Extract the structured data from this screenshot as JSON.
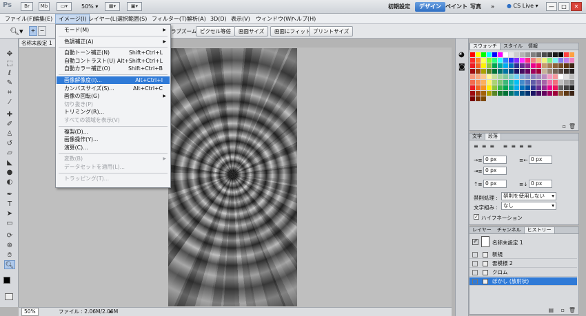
{
  "app": {
    "logo": "Ps",
    "zoom": "50%"
  },
  "workspace": {
    "buttons": [
      "初期設定",
      "デザイン",
      "ペイント",
      "写真"
    ],
    "active": 1,
    "more": "»",
    "cslive": "CS Live"
  },
  "window_controls": {
    "minimize": "—",
    "maximize": "□",
    "close": "✕"
  },
  "menubar": [
    "ファイル(F)",
    "編集(E)",
    "イメージ(I)",
    "レイヤー(L)",
    "選択範囲(S)",
    "フィルター(T)",
    "解析(A)",
    "3D(D)",
    "表示(V)",
    "ウィンドウ(W)",
    "ヘルプ(H)"
  ],
  "optionbar": {
    "partial_label": "ラブズーム",
    "buttons": [
      "ピクセル等倍",
      "画面サイズ",
      "画面にフィット",
      "プリントサイズ"
    ]
  },
  "document": {
    "tab": "名称未設定 1",
    "status_zoom": "50%",
    "status_file": "ファイル : 2.06M/2.06M"
  },
  "image_menu": {
    "items": [
      {
        "label": "モード(M)",
        "shortcut": "",
        "submenu": true,
        "disabled": false,
        "highlight": false
      },
      {
        "sep": true
      },
      {
        "label": "色調補正(A)",
        "shortcut": "",
        "submenu": true,
        "disabled": false,
        "highlight": false
      },
      {
        "sep": true
      },
      {
        "label": "自動トーン補正(N)",
        "shortcut": "Shift+Ctrl+L",
        "submenu": false,
        "disabled": false,
        "highlight": false
      },
      {
        "label": "自動コントラスト(U)",
        "shortcut": "Alt+Shift+Ctrl+L",
        "submenu": false,
        "disabled": false,
        "highlight": false
      },
      {
        "label": "自動カラー補正(O)",
        "shortcut": "Shift+Ctrl+B",
        "submenu": false,
        "disabled": false,
        "highlight": false
      },
      {
        "sep": true
      },
      {
        "label": "画像解像度(I)...",
        "shortcut": "Alt+Ctrl+I",
        "submenu": false,
        "disabled": false,
        "highlight": true
      },
      {
        "label": "カンバスサイズ(S)...",
        "shortcut": "Alt+Ctrl+C",
        "submenu": false,
        "disabled": false,
        "highlight": false
      },
      {
        "label": "画像の回転(G)",
        "shortcut": "",
        "submenu": true,
        "disabled": false,
        "highlight": false
      },
      {
        "label": "切り抜き(P)",
        "shortcut": "",
        "submenu": false,
        "disabled": true,
        "highlight": false
      },
      {
        "label": "トリミング(R)...",
        "shortcut": "",
        "submenu": false,
        "disabled": false,
        "highlight": false
      },
      {
        "label": "すべての領域を表示(V)",
        "shortcut": "",
        "submenu": false,
        "disabled": true,
        "highlight": false
      },
      {
        "sep": true
      },
      {
        "label": "複製(D)...",
        "shortcut": "",
        "submenu": false,
        "disabled": false,
        "highlight": false
      },
      {
        "label": "画像操作(Y)...",
        "shortcut": "",
        "submenu": false,
        "disabled": false,
        "highlight": false
      },
      {
        "label": "演算(C)...",
        "shortcut": "",
        "submenu": false,
        "disabled": false,
        "highlight": false
      },
      {
        "sep": true
      },
      {
        "label": "変数(B)",
        "shortcut": "",
        "submenu": true,
        "disabled": true,
        "highlight": false
      },
      {
        "label": "データセットを適用(L)...",
        "shortcut": "",
        "submenu": false,
        "disabled": true,
        "highlight": false
      },
      {
        "sep": true
      },
      {
        "label": "トラッピング(T)...",
        "shortcut": "",
        "submenu": false,
        "disabled": true,
        "highlight": false
      }
    ]
  },
  "swatch_panel": {
    "tabs": [
      "スウォッチ",
      "スタイル",
      "情報"
    ],
    "colors": [
      "#ff0000",
      "#ffff00",
      "#00ff00",
      "#00ffff",
      "#0000ff",
      "#ff00ff",
      "#ffffff",
      "#e6e6e6",
      "#cccccc",
      "#b3b3b3",
      "#999999",
      "#808080",
      "#666666",
      "#4d4d4d",
      "#333333",
      "#1a1a1a",
      "#000000",
      "#ff4040",
      "#ffa040",
      "#ff2a2a",
      "#ff7f2a",
      "#ffff55",
      "#7fff2a",
      "#2aff7f",
      "#2affff",
      "#2a7fff",
      "#2a2aff",
      "#7f2aff",
      "#ff2aff",
      "#ff2a7f",
      "#f08080",
      "#f0c080",
      "#f0f080",
      "#80f080",
      "#80f0f0",
      "#8080f0",
      "#c080f0",
      "#f080c0",
      "#ed1c24",
      "#f26522",
      "#fff200",
      "#8dc63f",
      "#00a651",
      "#00a99d",
      "#00aeef",
      "#0072bc",
      "#2e3192",
      "#662d91",
      "#92278f",
      "#ec008c",
      "#ed145b",
      "#c69c6d",
      "#a67c52",
      "#8c6239",
      "#754c24",
      "#603913",
      "#3c2415",
      "#9e0b0f",
      "#a0410d",
      "#aba000",
      "#598527",
      "#007236",
      "#00746b",
      "#0076a3",
      "#004a80",
      "#1b1464",
      "#440e62",
      "#630460",
      "#9e005d",
      "#9e0039",
      "#c7b299",
      "#998675",
      "#736357",
      "#534741",
      "#37302b",
      "#242020",
      "#f7977a",
      "#f9ad81",
      "#fdc68a",
      "#fff79a",
      "#c4df9b",
      "#a2d39c",
      "#82ca9d",
      "#7bcdc8",
      "#6ecff6",
      "#7ea7d8",
      "#8493ca",
      "#8882be",
      "#a187be",
      "#bc8dbf",
      "#f49ac2",
      "#f6989d",
      "#ffffff",
      "#e0e0e0",
      "#bdbdbd",
      "#f26c4f",
      "#f68e55",
      "#fbaf5c",
      "#fff467",
      "#acd372",
      "#7cc576",
      "#3bb878",
      "#1abbb4",
      "#00bff3",
      "#438ccb",
      "#5574b9",
      "#605ca8",
      "#855fa8",
      "#a763a8",
      "#f06ea9",
      "#f26d7d",
      "#c0c0c0",
      "#a0a0a0",
      "#808080",
      "#ed1c24",
      "#f26522",
      "#f7941d",
      "#fff200",
      "#8dc63f",
      "#39b54a",
      "#00a651",
      "#00a99d",
      "#00aeef",
      "#0072bc",
      "#0054a6",
      "#2e3192",
      "#662d91",
      "#92278f",
      "#ec008c",
      "#ed145b",
      "#606060",
      "#404040",
      "#202020",
      "#9e0b0f",
      "#a0410d",
      "#a36209",
      "#aba000",
      "#598527",
      "#197b30",
      "#007236",
      "#00746b",
      "#0076a3",
      "#004b80",
      "#003471",
      "#1b1464",
      "#440e62",
      "#630460",
      "#9e005d",
      "#9e0039",
      "#8c6239",
      "#603913",
      "#3c2415",
      "#790000",
      "#7b2e00",
      "#7d4900"
    ]
  },
  "paragraph_panel": {
    "tabs": [
      "文字",
      "段落"
    ],
    "indent_left": "0 px",
    "indent_right": "0 px",
    "indent_first": "0 px",
    "space_before": "0 px",
    "space_after": "0 px",
    "kinsoku_label": "禁則処理 :",
    "kinsoku_value": "禁則を使用しない",
    "mojikumi_label": "文字組み :",
    "mojikumi_value": "なし",
    "hyphenation": "ハイフネーション"
  },
  "history_panel": {
    "tabs": [
      "レイヤー",
      "チャンネル",
      "ヒストリー"
    ],
    "snapshot": "名称未設定 1",
    "rows": [
      "新規",
      "雲模様 2",
      "クロム",
      "ぼかし (放射状)"
    ],
    "selected": 3
  },
  "colors": {
    "accent": "#2f7ad7",
    "canvas_bg": "#bfbfbf"
  }
}
